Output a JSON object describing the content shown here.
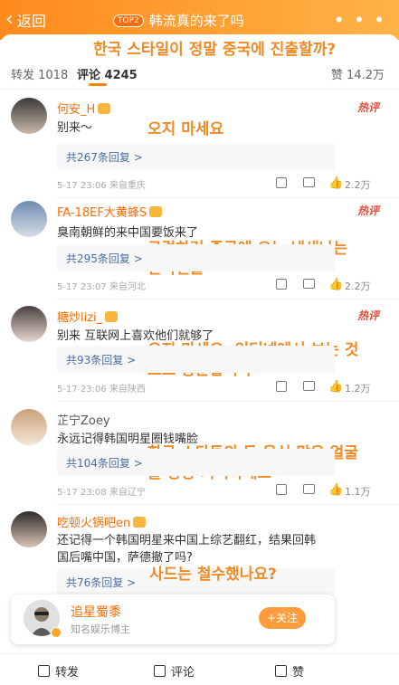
{
  "header": {
    "back_label": "返回",
    "topic_badge": "TOP2",
    "topic_title": "韩流真的来了吗",
    "more_label": "• • •"
  },
  "tabs": {
    "repost": "转发 1018",
    "comment": "评论 4245",
    "like": "赞 14.2万"
  },
  "annotations": {
    "title_kr": "한국 스타일이 정말 중국에 진출할까?",
    "c1_kr": "오지 마세요",
    "c2_kr_line1": "구걸하러 중국에 오는 냄새나는",
    "c2_kr_line2": "한국인들",
    "c3_kr_line1": "오지 마세요, 인터넷에서 보는 것",
    "c3_kr_line2": "으로 충분합니다",
    "c4_kr_line1": "한국 스타들의 돈 욕심 많은 얼굴",
    "c4_kr_line2": "을 항상 기억하세요",
    "c5_kr": "사드는 철수했나요?"
  },
  "comments": [
    {
      "user": "何安_H",
      "hot": "热评",
      "text": "别来～",
      "replies": "共267条回复 >",
      "time": "5-17 23:06",
      "location": "来自重庆",
      "likes": "2.2万"
    },
    {
      "user": "FA-18EF大黄蜂S",
      "hot": "热评",
      "text": "臭南朝鲜的来中国要饭来了",
      "replies": "共295条回复 >",
      "time": "5-17 23:07",
      "location": "来自河北",
      "likes": "2.2万"
    },
    {
      "user": "糖炒lizi_",
      "hot": "热评",
      "text": "别来 互联网上喜欢他们就够了",
      "replies": "共93条回复 >",
      "time": "5-17 23:06",
      "location": "来自陕西",
      "likes": "1.2万"
    },
    {
      "user": "芷宁Zoey",
      "hot": "",
      "text": "永远记得韩国明星圈钱嘴脸",
      "replies": "共104条回复 >",
      "time": "5-17 23:08",
      "location": "来自辽宁",
      "likes": "1.1万"
    },
    {
      "user": "吃顿火锅吧en",
      "hot": "",
      "text_line1": "还记得一个韩国明星来中国上综艺翻红，结果回韩",
      "text_line2": "国后嘴中国，萨德撤了吗?",
      "replies": "共76条回复 >"
    }
  ],
  "follow_card": {
    "name": "追星蜀黍",
    "desc": "知名娱乐博主",
    "button": "+关注"
  },
  "bottom_bar": {
    "repost": "转发",
    "comment": "评论",
    "like": "赞"
  }
}
